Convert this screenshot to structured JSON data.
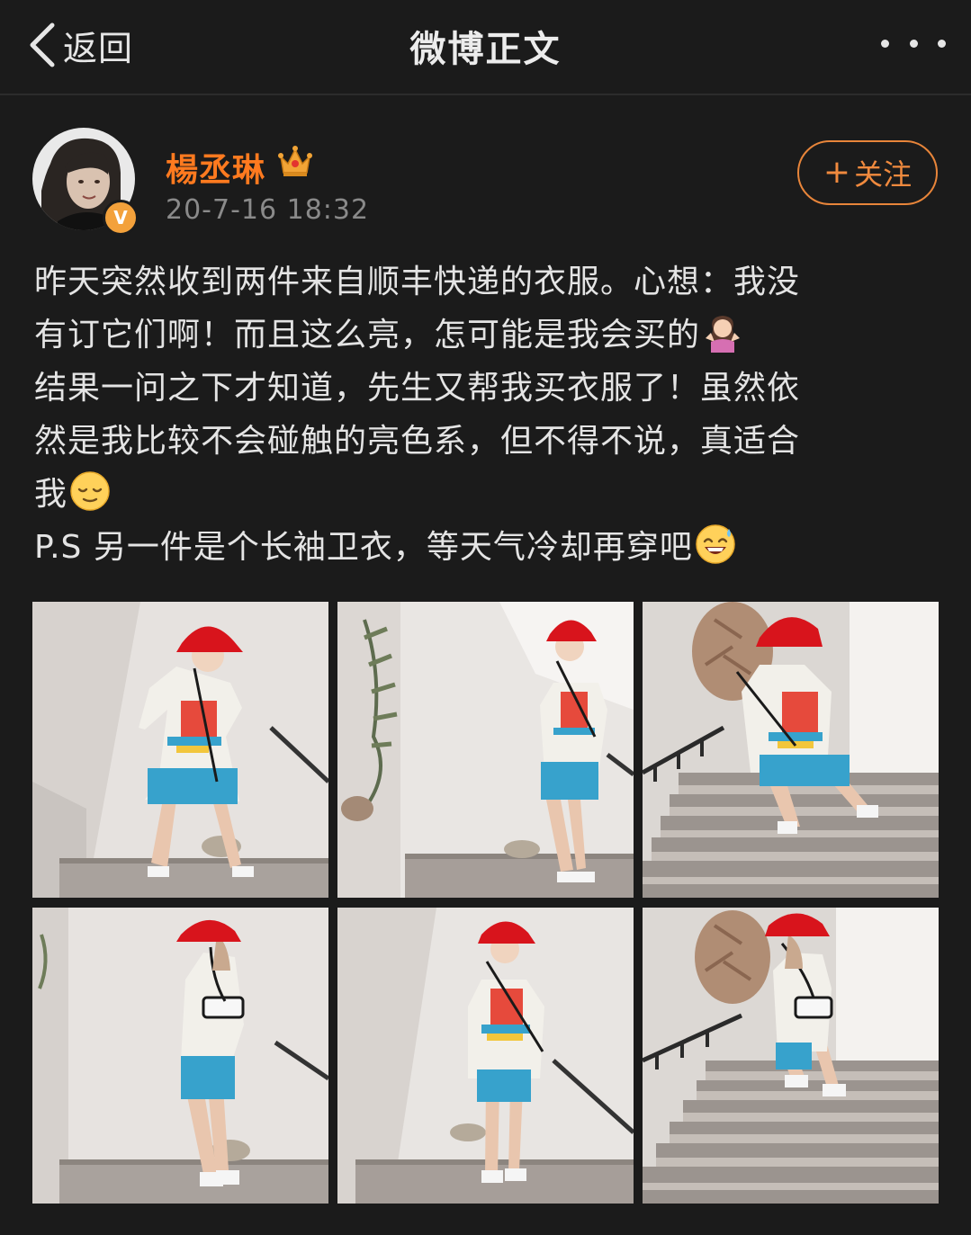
{
  "nav": {
    "back_label": "返回",
    "title": "微博正文",
    "back_icon": "chevron-left-icon",
    "more_icon": "more-dots-icon"
  },
  "author": {
    "name": "楊丞琳",
    "badge_icon": "crown-icon",
    "verified_icon": "verified-v-icon",
    "verified_mark": "V",
    "timestamp": "20-7-16 18:32"
  },
  "follow": {
    "plus": "+",
    "label": "关注"
  },
  "post": {
    "lines": [
      "昨天突然收到两件来自顺丰快递的衣服。心想：我没",
      "有订它们啊！而且这么亮，怎可能是我会买的",
      "结果一问之下才知道，先生又帮我买衣服了！虽然依",
      "然是我比较不会碰触的亮色系，但不得不说，真适合",
      "我",
      "P.S 另一件是个长袖卫衣，等天气冷却再穿吧"
    ],
    "emojis": [
      "shrug-emoji",
      "relieved-emoji",
      "sweat-smile-emoji"
    ]
  },
  "photos": {
    "count": 6,
    "items": [
      "photo-1",
      "photo-2",
      "photo-3",
      "photo-4",
      "photo-5",
      "photo-6"
    ]
  },
  "colors": {
    "background": "#1b1b1b",
    "name": "#ff7a1f",
    "follow_border": "#e8853a",
    "hat": "#d8141c",
    "shorts": "#3aa0c8"
  }
}
